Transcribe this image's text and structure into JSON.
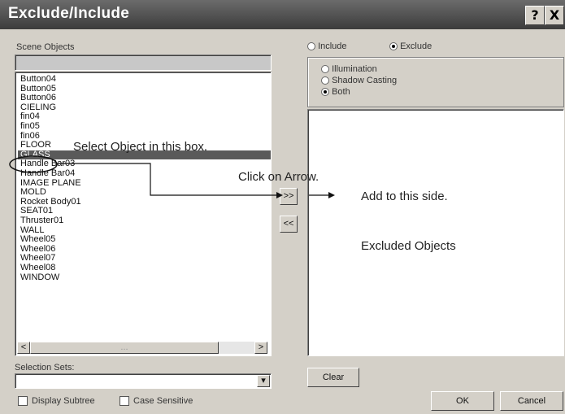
{
  "window": {
    "title": "Exclude/Include",
    "help_label": "?",
    "close_label": "X"
  },
  "scene": {
    "label": "Scene Objects",
    "items": [
      "Button04",
      "Button05",
      "Button06",
      "CIELING",
      "fin04",
      "fin05",
      "fin06",
      "FLOOR",
      "GLASS",
      "Handle Bar03",
      "Handle Bar04",
      "IMAGE PLANE",
      "MOLD",
      "Rocket Body01",
      "SEAT01",
      "Thruster01",
      "WALL",
      "Wheel05",
      "Wheel06",
      "Wheel07",
      "Wheel08",
      "WINDOW"
    ],
    "selected": "GLASS"
  },
  "arrows": {
    "add": ">>",
    "remove": "<<"
  },
  "scroll": {
    "left": "<",
    "right": ">",
    "thumb_label": "..."
  },
  "mode": {
    "include_label": "Include",
    "exclude_label": "Exclude",
    "selected": "Exclude"
  },
  "type_options": {
    "illumination": "Illumination",
    "shadow": "Shadow Casting",
    "both": "Both",
    "selected": "Both"
  },
  "selection_sets": {
    "label": "Selection Sets:",
    "dropdown_arrow": "▾",
    "value": ""
  },
  "display_subtree": "Display Subtree",
  "case_sensitive": "Case Sensitive",
  "buttons": {
    "clear": "Clear",
    "ok": "OK",
    "cancel": "Cancel"
  },
  "annotations": {
    "select": "Select Object in this box.",
    "click": "Click on Arrow.",
    "add": "Add to this side.",
    "excluded": "Excluded Objects"
  }
}
